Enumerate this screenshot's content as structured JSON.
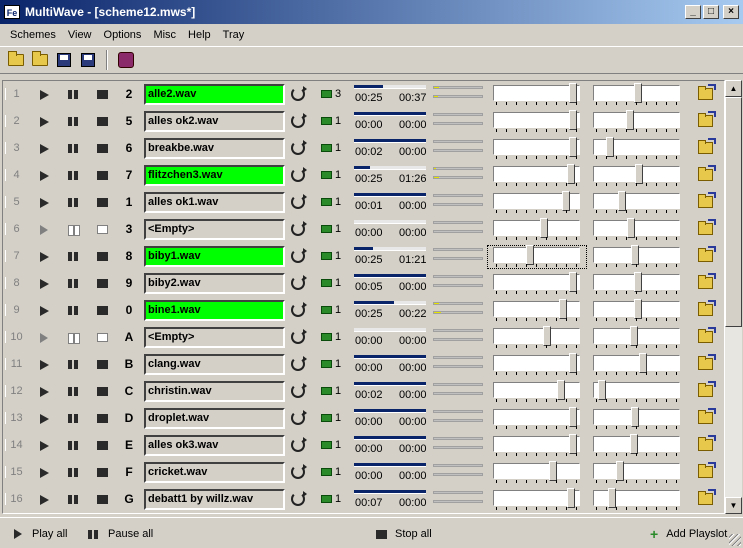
{
  "window": {
    "app_icon_text": "Fe",
    "title": "MultiWave - [scheme12.mws*]",
    "minimize": "_",
    "maximize": "□",
    "close": "×"
  },
  "menu": [
    "Schemes",
    "View",
    "Options",
    "Misc",
    "Help",
    "Tray"
  ],
  "toolbar": {
    "icons": [
      "open-folder-icon",
      "open-numbered-icon",
      "save-icon",
      "save-as-icon",
      "settings-icon"
    ]
  },
  "playslots": [
    {
      "slot": "1",
      "key": "2",
      "file": "alle2.wav",
      "loaded": true,
      "count": "3",
      "progress": 0.4,
      "elapsed": "00:25",
      "remaining": "00:37",
      "meter_l": 0.1,
      "meter_r": 0.08,
      "volume": 0.95,
      "pan": 0.5
    },
    {
      "slot": "2",
      "key": "5",
      "file": "alles ok2.wav",
      "loaded": false,
      "count": "1",
      "progress": 1.0,
      "elapsed": "00:00",
      "remaining": "00:00",
      "meter_l": 0,
      "meter_r": 0,
      "volume": 0.95,
      "pan": 0.4
    },
    {
      "slot": "3",
      "key": "6",
      "file": "breakbe.wav",
      "loaded": false,
      "count": "1",
      "progress": 1.0,
      "elapsed": "00:02",
      "remaining": "00:00",
      "meter_l": 0,
      "meter_r": 0,
      "volume": 0.95,
      "pan": 0.15
    },
    {
      "slot": "4",
      "key": "7",
      "file": "flitzchen3.wav",
      "loaded": true,
      "count": "1",
      "progress": 0.22,
      "elapsed": "00:25",
      "remaining": "01:26",
      "meter_l": 0.05,
      "meter_r": 0.1,
      "volume": 0.93,
      "pan": 0.52
    },
    {
      "slot": "5",
      "key": "1",
      "file": "alles ok1.wav",
      "loaded": false,
      "count": "1",
      "progress": 1.0,
      "elapsed": "00:01",
      "remaining": "00:00",
      "meter_l": 0,
      "meter_r": 0,
      "volume": 0.86,
      "pan": 0.3
    },
    {
      "slot": "6",
      "key": "3",
      "file": "<Empty>",
      "loaded": false,
      "empty": true,
      "count": "1",
      "progress": 0,
      "elapsed": "00:00",
      "remaining": "00:00",
      "meter_l": 0,
      "meter_r": 0,
      "volume": 0.58,
      "pan": 0.42
    },
    {
      "slot": "7",
      "key": "8",
      "file": "biby1.wav",
      "loaded": true,
      "count": "1",
      "progress": 0.26,
      "elapsed": "00:25",
      "remaining": "01:21",
      "meter_l": 0,
      "meter_r": 0,
      "volume": 0.4,
      "pan": 0.47,
      "focused": true
    },
    {
      "slot": "8",
      "key": "9",
      "file": "biby2.wav",
      "loaded": false,
      "count": "1",
      "progress": 1.0,
      "elapsed": "00:05",
      "remaining": "00:00",
      "meter_l": 0,
      "meter_r": 0,
      "volume": 0.95,
      "pan": 0.5
    },
    {
      "slot": "9",
      "key": "0",
      "file": "bine1.wav",
      "loaded": true,
      "count": "1",
      "progress": 0.55,
      "elapsed": "00:25",
      "remaining": "00:22",
      "meter_l": 0.1,
      "meter_r": 0.15,
      "volume": 0.82,
      "pan": 0.5
    },
    {
      "slot": "10",
      "key": "A",
      "file": "<Empty>",
      "loaded": false,
      "empty": true,
      "count": "1",
      "progress": 0,
      "elapsed": "00:00",
      "remaining": "00:00",
      "meter_l": 0,
      "meter_r": 0,
      "volume": 0.62,
      "pan": 0.45
    },
    {
      "slot": "11",
      "key": "B",
      "file": "clang.wav",
      "loaded": false,
      "count": "1",
      "progress": 1.0,
      "elapsed": "00:00",
      "remaining": "00:00",
      "meter_l": 0,
      "meter_r": 0,
      "volume": 0.95,
      "pan": 0.57
    },
    {
      "slot": "12",
      "key": "C",
      "file": "christin.wav",
      "loaded": false,
      "count": "1",
      "progress": 1.0,
      "elapsed": "00:02",
      "remaining": "00:00",
      "meter_l": 0,
      "meter_r": 0,
      "volume": 0.8,
      "pan": 0.05
    },
    {
      "slot": "13",
      "key": "D",
      "file": "droplet.wav",
      "loaded": false,
      "count": "1",
      "progress": 1.0,
      "elapsed": "00:00",
      "remaining": "00:00",
      "meter_l": 0,
      "meter_r": 0,
      "volume": 0.95,
      "pan": 0.47
    },
    {
      "slot": "14",
      "key": "E",
      "file": "alles ok3.wav",
      "loaded": false,
      "count": "1",
      "progress": 1.0,
      "elapsed": "00:00",
      "remaining": "00:00",
      "meter_l": 0,
      "meter_r": 0,
      "volume": 0.95,
      "pan": 0.45
    },
    {
      "slot": "15",
      "key": "F",
      "file": "cricket.wav",
      "loaded": false,
      "count": "1",
      "progress": 1.0,
      "elapsed": "00:00",
      "remaining": "00:00",
      "meter_l": 0,
      "meter_r": 0,
      "volume": 0.7,
      "pan": 0.28
    },
    {
      "slot": "16",
      "key": "G",
      "file": "debatt1 by willz.wav",
      "loaded": false,
      "count": "1",
      "progress": 1.0,
      "elapsed": "00:07",
      "remaining": "00:00",
      "meter_l": 0,
      "meter_r": 0,
      "volume": 0.93,
      "pan": 0.18
    }
  ],
  "bottombar": {
    "play_all": "Play all",
    "pause_all": "Pause all",
    "stop_all": "Stop all",
    "add_playslot": "Add Playslot"
  },
  "colors": {
    "loaded_file": "#00ff00",
    "progress": "#0a246a",
    "meter": "#e6e600"
  }
}
